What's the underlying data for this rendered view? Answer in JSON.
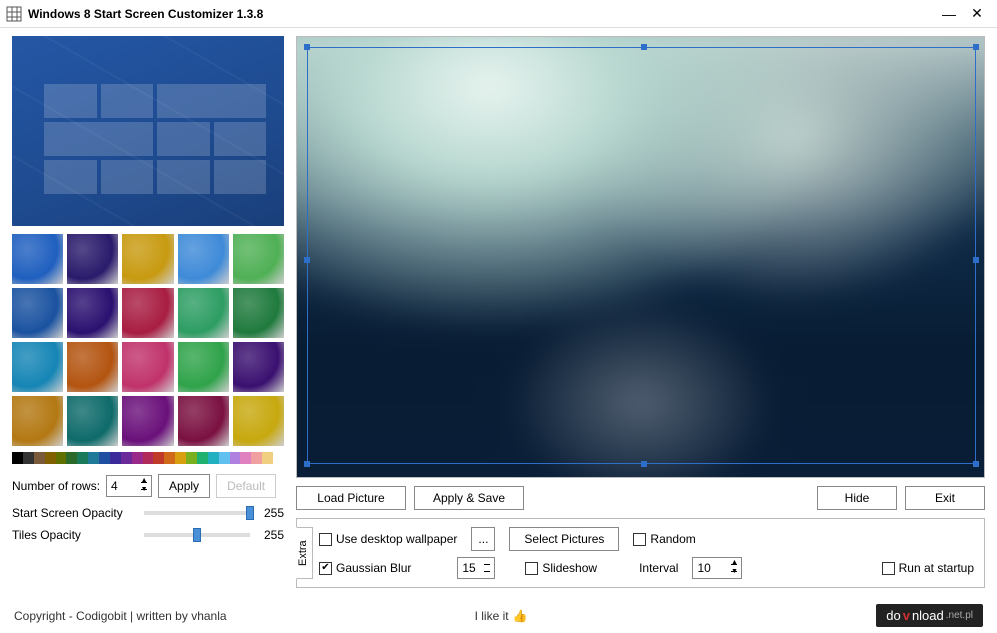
{
  "window": {
    "title": "Windows 8 Start Screen Customizer 1.3.8"
  },
  "swatch_colors": [
    "#1f5fbf",
    "#2a1a6b",
    "#c89a10",
    "#3e8ad8",
    "#4fb055",
    "#1a52a0",
    "#2a1070",
    "#a81d42",
    "#2d9d63",
    "#1f7a3d",
    "#1585b5",
    "#b35410",
    "#c0326b",
    "#2fa34a",
    "#3a1070",
    "#b37812",
    "#0e6a6a",
    "#6a107a",
    "#7a1040",
    "#c7a80e"
  ],
  "colorbar": [
    "#000",
    "#333",
    "#7a5a3a",
    "#806000",
    "#607000",
    "#2a6a2a",
    "#1a7a5a",
    "#1f7a9a",
    "#1f4fa0",
    "#3a2a9a",
    "#6a2a9a",
    "#9a2a8a",
    "#b02a5a",
    "#c03a2a",
    "#d06a1a",
    "#d8a010",
    "#7ab020",
    "#20b070",
    "#20b0c0",
    "#60c0f0",
    "#b080e0",
    "#e080c0",
    "#f0a0a0",
    "#f0d080",
    "#fff"
  ],
  "rows": {
    "label": "Number of rows:",
    "value": "4",
    "apply": "Apply",
    "default": "Default"
  },
  "opacity1": {
    "label": "Start Screen Opacity",
    "value": "255",
    "pos": 96
  },
  "opacity2": {
    "label": "Tiles Opacity",
    "value": "255",
    "pos": 46
  },
  "actions": {
    "load": "Load Picture",
    "applysave": "Apply & Save",
    "hide": "Hide",
    "exit": "Exit"
  },
  "extra": {
    "tab": "Extra",
    "desktop": "Use desktop wallpaper",
    "browse": "...",
    "select": "Select Pictures",
    "random": "Random",
    "gaussian": "Gaussian Blur",
    "gaussian_val": "15",
    "slideshow": "Slideshow",
    "interval": "Interval",
    "interval_val": "10",
    "startup": "Run at startup"
  },
  "footer": {
    "copyright": "Copyright - Codigobit | written by vhanla",
    "like": "I like it",
    "dl_prefix": "do",
    "dl_v": "v",
    "dl_rest": "nload",
    "dl_suffix": ".net.pl"
  }
}
